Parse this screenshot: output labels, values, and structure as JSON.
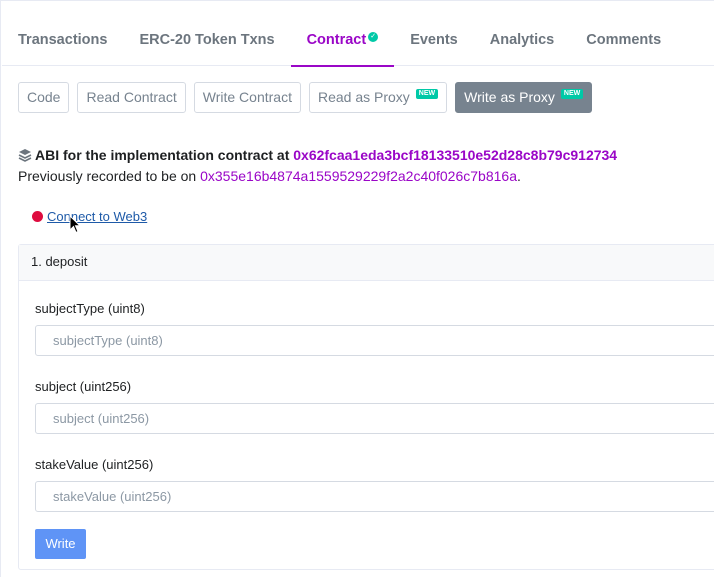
{
  "tabs": [
    {
      "label": "Transactions",
      "active": false
    },
    {
      "label": "ERC-20 Token Txns",
      "active": false
    },
    {
      "label": "Contract",
      "active": true,
      "verified_icon": "check-circle-icon"
    },
    {
      "label": "Events",
      "active": false
    },
    {
      "label": "Analytics",
      "active": false
    },
    {
      "label": "Comments",
      "active": false
    }
  ],
  "subtabs": [
    {
      "label": "Code",
      "active": false,
      "badge": ""
    },
    {
      "label": "Read Contract",
      "active": false,
      "badge": ""
    },
    {
      "label": "Write Contract",
      "active": false,
      "badge": ""
    },
    {
      "label": "Read as Proxy",
      "active": false,
      "badge": "NEW"
    },
    {
      "label": "Write as Proxy",
      "active": true,
      "badge": "NEW"
    }
  ],
  "abi": {
    "icon": "layers-icon",
    "prefix": "ABI for the implementation contract at ",
    "address": "0x62fcaa1eda3bcf18133510e52d28c8b79c912734",
    "previous_prefix": "Previously recorded to be on ",
    "previous_address": "0x355e16b4874a1559529229f2a2c40f026c7b816a",
    "previous_suffix": "."
  },
  "connect": {
    "status_color": "#de0c3f",
    "label": "Connect to Web3"
  },
  "functions": [
    {
      "title": "1. deposit",
      "inputs": [
        {
          "label": "subjectType (uint8)",
          "placeholder": "subjectType (uint8)",
          "value": ""
        },
        {
          "label": "subject (uint256)",
          "placeholder": "subject (uint256)",
          "value": ""
        },
        {
          "label": "stakeValue (uint256)",
          "placeholder": "stakeValue (uint256)",
          "value": ""
        }
      ],
      "button": "Write"
    }
  ],
  "colors": {
    "accent": "#9a06c7",
    "new_badge": "#00c9a7",
    "write_button": "#5f94f6"
  }
}
